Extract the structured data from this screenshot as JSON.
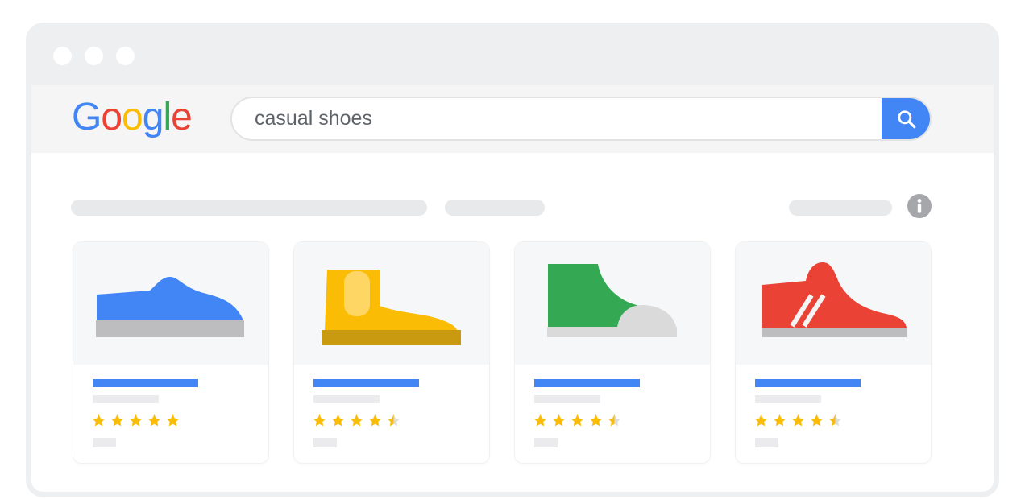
{
  "browser": {
    "window_controls": [
      "dot",
      "dot",
      "dot"
    ]
  },
  "header": {
    "logo": {
      "letters": [
        {
          "char": "G",
          "color": "#4285f4"
        },
        {
          "char": "o",
          "color": "#ea4335"
        },
        {
          "char": "o",
          "color": "#fbbc05"
        },
        {
          "char": "g",
          "color": "#4285f4"
        },
        {
          "char": "l",
          "color": "#34a853"
        },
        {
          "char": "e",
          "color": "#ea4335"
        }
      ]
    },
    "search": {
      "value": "casual shoes",
      "button_icon": "search-icon",
      "button_color": "#4285f4"
    }
  },
  "toolbar": {
    "info_icon": "info-icon"
  },
  "products": [
    {
      "shoe": "blue-sneaker",
      "color": "#4285f4",
      "rating": 5
    },
    {
      "shoe": "yellow-chelsea-boot",
      "color": "#fbbc05",
      "rating": 4.5
    },
    {
      "shoe": "green-high-top",
      "color": "#34a853",
      "rating": 4.5
    },
    {
      "shoe": "red-striped-sneaker",
      "color": "#ea4335",
      "rating": 4.5
    }
  ],
  "colors": {
    "star": "#fbbc05",
    "star_empty": "#dcdcdc",
    "accent": "#4285f4"
  }
}
